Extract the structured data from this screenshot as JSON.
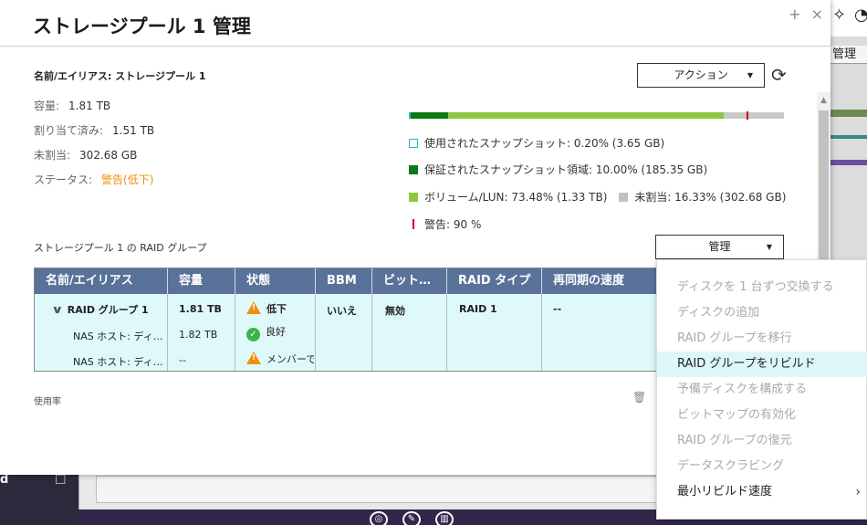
{
  "dialog": {
    "title": "ストレージプール 1 管理",
    "controls": {
      "maximize": "+",
      "close": "×"
    }
  },
  "pool": {
    "name_label": "名前/エイリアス: ストレージプール 1",
    "capacity_label": "容量:",
    "capacity_value": "1.81 TB",
    "allocated_label": "割り当て済み:",
    "allocated_value": "1.51 TB",
    "unallocated_label": "未割当:",
    "unallocated_value": "302.68 GB",
    "status_label": "ステータス:",
    "status_value": "警告(低下)"
  },
  "action_button": {
    "label": "アクション"
  },
  "usage_bar": {
    "snapshot_used_pct": 0.2,
    "guaranteed_snapshot_pct": 10.0,
    "volume_pct": 73.48,
    "unallocated_pct": 16.33,
    "warning_pct": 90
  },
  "legend": {
    "snapshot": "使用されたスナップショット: 0.20% (3.65 GB)",
    "guaranteed": "保証されたスナップショット領域: 10.00% (185.35 GB)",
    "volume": "ボリューム/LUN: 73.48% (1.33 TB)",
    "unallocated": "未割当: 16.33% (302.68 GB)",
    "warning": "警告: 90 %"
  },
  "raid_section": {
    "title": "ストレージプール 1 の RAID グループ",
    "manage_label": "管理"
  },
  "raid_table": {
    "headers": [
      "名前/エイリアス",
      "容量",
      "状態",
      "BBM",
      "ビット…",
      "RAID タイプ",
      "再同期の速度"
    ],
    "rows": [
      {
        "name": "RAID グループ 1",
        "capacity": "1.81 TB",
        "status": "低下",
        "bbm": "いいえ",
        "bitmap": "無効",
        "raid_type": "RAID 1",
        "resync": "--"
      },
      {
        "name": "NAS ホスト: ディ…",
        "capacity": "1.82 TB",
        "status": "良好"
      },
      {
        "name": "NAS ホスト: ディ…",
        "capacity": "--",
        "status": "メンバーで"
      }
    ]
  },
  "below_table": {
    "label": "使用率"
  },
  "manage_menu": {
    "items": [
      {
        "label": "ディスクを 1 台ずつ交換する",
        "state": "disabled"
      },
      {
        "label": "ディスクの追加",
        "state": "disabled"
      },
      {
        "label": "RAID グループを移行",
        "state": "disabled"
      },
      {
        "label": "RAID グループをリビルド",
        "state": "hover"
      },
      {
        "label": "予備ディスクを構成する",
        "state": "disabled"
      },
      {
        "label": "ビットマップの有効化",
        "state": "disabled"
      },
      {
        "label": "RAID グループの復元",
        "state": "disabled"
      },
      {
        "label": "データスクラビング",
        "state": "disabled"
      },
      {
        "label": "最小リビルド速度",
        "state": "enabled"
      }
    ]
  },
  "background": {
    "manage_tab": "管理",
    "left_label": "d"
  },
  "colors": {
    "header": "#597299",
    "table_bg": "#dff9fa",
    "warning": "#f0900a",
    "volume": "#8dc63f",
    "guaranteed": "#0d7a12",
    "snapshot": "#29b6d6",
    "alert_line": "#d0021b"
  }
}
